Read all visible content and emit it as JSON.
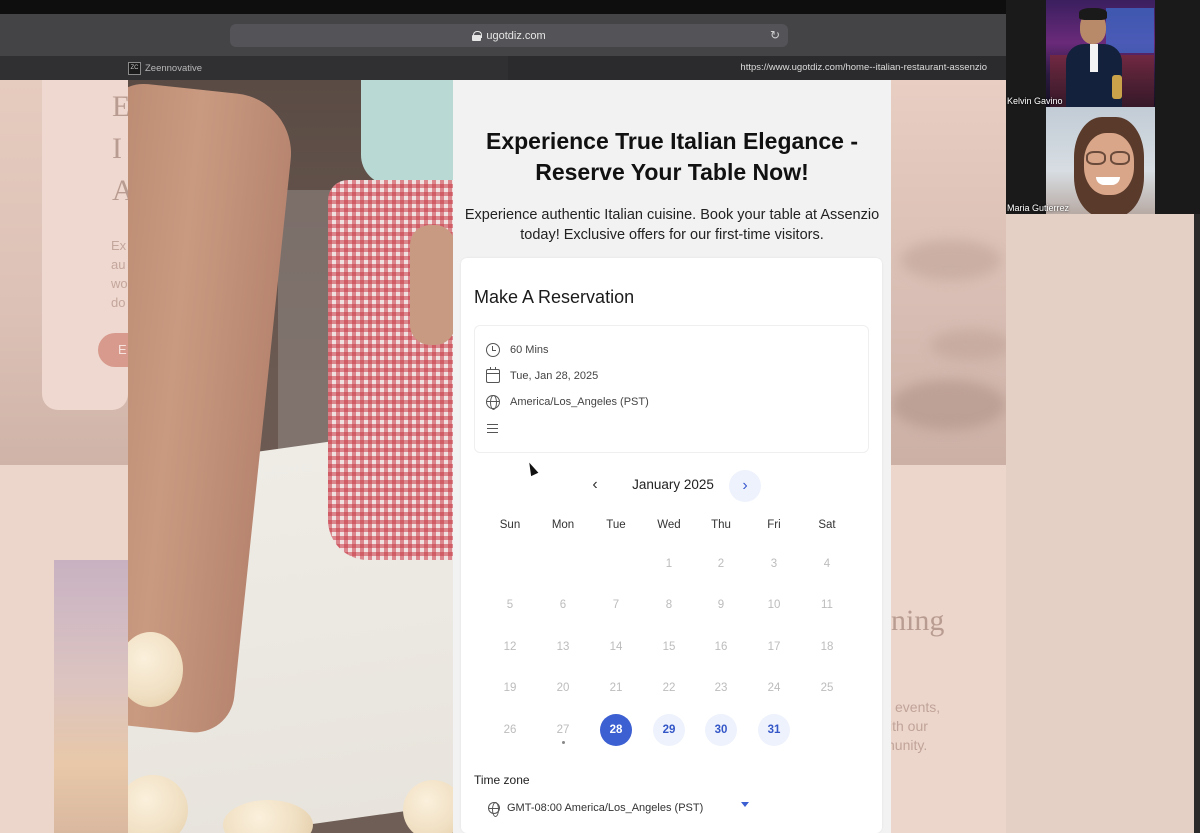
{
  "browser": {
    "address": "ugotdiz.com",
    "tab_title": "Zeennovative",
    "tab_favicon": "ZC",
    "full_url": "https://www.ugotdiz.com/home--italian-restaurant-assenzio"
  },
  "background_site": {
    "heading_chars": [
      "E",
      "I",
      "A"
    ],
    "text_fragments": [
      "Ex",
      "au",
      "wo",
      "do"
    ],
    "button_fragment": "E",
    "right_heading_fragment": "ning",
    "right_text": [
      "events,",
      "ith our",
      "nunity."
    ]
  },
  "hero": {
    "title": "Experience True Italian Elegance - Reserve Your Table Now!",
    "subtitle": "Experience authentic Italian cuisine. Book your table at Assenzio today! Exclusive offers for our first-time visitors."
  },
  "reservation": {
    "title": "Make A Reservation",
    "duration": "60 Mins",
    "date": "Tue, Jan 28, 2025",
    "timezone": "America/Los_Angeles (PST)",
    "notes": ""
  },
  "calendar": {
    "month_label": "January 2025",
    "weekdays": [
      "Sun",
      "Mon",
      "Tue",
      "Wed",
      "Thu",
      "Fri",
      "Sat"
    ],
    "first_weekday_index": 3,
    "days_in_month": 31,
    "today": 27,
    "selected": 28,
    "available": [
      28,
      29,
      30,
      31
    ]
  },
  "timezone_section": {
    "label": "Time zone",
    "selected": "GMT-08:00 America/Los_Angeles (PST)"
  },
  "video_call": {
    "participants": [
      {
        "name": "Kelvin Gavino"
      },
      {
        "name": "Maria Gutierrez"
      }
    ]
  },
  "colors": {
    "accent": "#3c5fd2",
    "available_bg": "#eef2fc",
    "page_bg": "#e9d4ca"
  }
}
